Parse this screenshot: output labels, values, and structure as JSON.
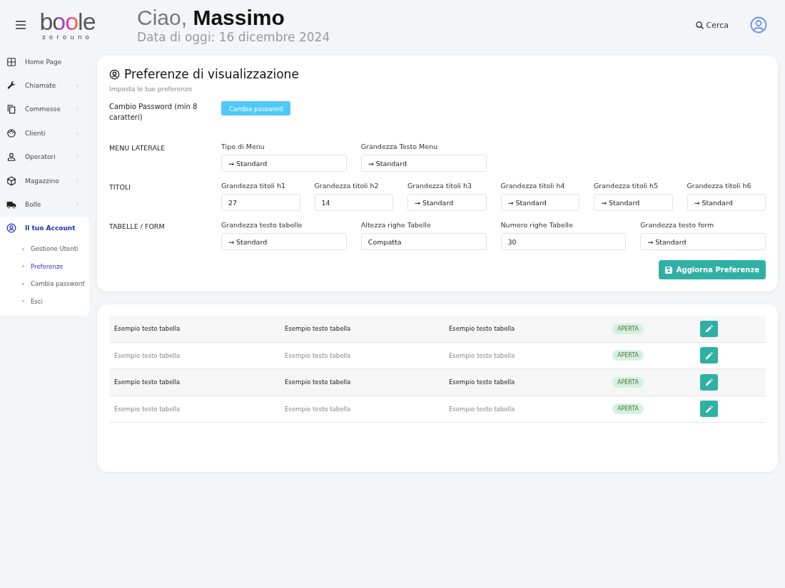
{
  "header": {
    "logo": {
      "word": "boole",
      "tagline": "zerouno"
    },
    "greeting": "Ciao,",
    "user_name": "Massimo",
    "date": "Data di oggi: 16 dicembre 2024",
    "search_label": "Cerca"
  },
  "sidebar": {
    "items": [
      {
        "label": "Home Page",
        "has_submenu": false,
        "selected": false
      },
      {
        "label": "Chiamate",
        "has_submenu": true,
        "selected": false
      },
      {
        "label": "Commesse",
        "has_submenu": true,
        "selected": false
      },
      {
        "label": "Clienti",
        "has_submenu": true,
        "selected": false
      },
      {
        "label": "Operatori",
        "has_submenu": true,
        "selected": false
      },
      {
        "label": "Magazzino",
        "has_submenu": true,
        "selected": false
      },
      {
        "label": "Bolle",
        "has_submenu": true,
        "selected": false
      },
      {
        "label": "Il tuo Account",
        "has_submenu": false,
        "selected": true,
        "expanded": true,
        "children": [
          {
            "label": "Gestione Utenti",
            "selected": false
          },
          {
            "label": "Preferenze",
            "selected": true
          },
          {
            "label": "Cambia password",
            "selected": false
          },
          {
            "label": "Esci",
            "selected": false
          }
        ]
      }
    ]
  },
  "preferences": {
    "title": "Preferenze di visualizzazione",
    "subtitle": "Imposta le tue preferenze",
    "password": {
      "label": "Cambio Password (min 8 caratteri)",
      "button": "Cambia password"
    },
    "sections": [
      {
        "title": "MENU LATERALE",
        "fields": [
          {
            "label": "Tipo di Menu",
            "value": "→ Standard"
          },
          {
            "label": "Grandezza Testo Menu",
            "value": "→ Standard"
          }
        ]
      },
      {
        "title": "TITOLI",
        "fields": [
          {
            "label": "Grandezza titoli h1",
            "value": "27"
          },
          {
            "label": "Grandezza titoli h2",
            "value": "14"
          },
          {
            "label": "Grandezza titoli h3",
            "value": "→ Standard"
          },
          {
            "label": "Grandezza titoli h4",
            "value": "→ Standard"
          },
          {
            "label": "Grandezza titoli h5",
            "value": "→ Standard"
          },
          {
            "label": "Grandezza titoli h6",
            "value": "→ Standard"
          }
        ]
      },
      {
        "title": "TABELLE / FORM",
        "fields": [
          {
            "label": "Grandezza testo tabelle",
            "value": "→ Standard"
          },
          {
            "label": "Altezza righe Tabelle",
            "value": "Compatta"
          },
          {
            "label": "Numero righe Tabelle",
            "value": "30"
          },
          {
            "label": "Grandezza testo form",
            "value": "→ Standard"
          }
        ]
      }
    ],
    "save_button": "Aggiorna Preferenze"
  },
  "table": {
    "rows": [
      {
        "cells": [
          "Esempio testo tabella",
          "Esempio testo tabella",
          "Esempio testo tabella"
        ],
        "status": "APERTA"
      },
      {
        "cells": [
          "Esempio testo tabella",
          "Esempio testo tabella",
          "Esempio testo tabella"
        ],
        "status": "APERTA"
      },
      {
        "cells": [
          "Esempio testo tabella",
          "Esempio testo tabella",
          "Esempio testo tabella"
        ],
        "status": "APERTA"
      },
      {
        "cells": [
          "Esempio testo tabella",
          "Esempio testo tabella",
          "Esempio testo tabella"
        ],
        "status": "APERTA"
      }
    ]
  }
}
